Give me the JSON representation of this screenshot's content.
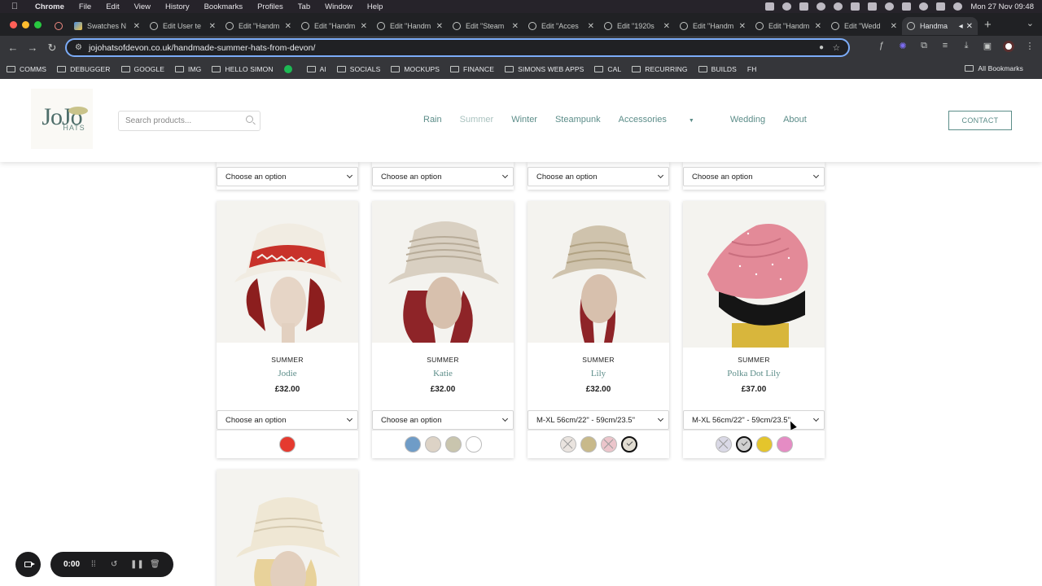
{
  "macos": {
    "app": "Chrome",
    "menus": [
      "File",
      "Edit",
      "View",
      "History",
      "Bookmarks",
      "Profiles",
      "Tab",
      "Window",
      "Help"
    ],
    "clock": "Mon 27 Nov  09:48"
  },
  "tabs": [
    {
      "title": "Swatches N"
    },
    {
      "title": "Edit User te"
    },
    {
      "title": "Edit \"Handm"
    },
    {
      "title": "Edit \"Handm"
    },
    {
      "title": "Edit \"Handm"
    },
    {
      "title": "Edit \"Steam"
    },
    {
      "title": "Edit \"Acces"
    },
    {
      "title": "Edit \"1920s"
    },
    {
      "title": "Edit \"Handm"
    },
    {
      "title": "Edit \"Handm"
    },
    {
      "title": "Edit \"Wedd"
    },
    {
      "title": "Handma"
    }
  ],
  "browser": {
    "url": "jojohatsofdevon.co.uk/handmade-summer-hats-from-devon/"
  },
  "bookmarks": [
    "COMMS",
    "DEBUGGER",
    "GOOGLE",
    "IMG",
    "HELLO SIMON",
    "AI",
    "SOCIALS",
    "MOCKUPS",
    "FINANCE",
    "SIMONS WEB APPS",
    "CAL",
    "RECURRING",
    "BUILDS",
    "FH"
  ],
  "bookmarks_all": "All Bookmarks",
  "site": {
    "logo_top": "JoJo",
    "logo_bottom": "HATS",
    "search_placeholder": "Search products...",
    "nav": [
      "Rain",
      "Summer",
      "Winter",
      "Steampunk",
      "Accessories",
      "Wedding",
      "About"
    ],
    "contact": "CONTACT"
  },
  "top_selects": [
    "Choose an option",
    "Choose an option",
    "Choose an option",
    "Choose an option"
  ],
  "products": [
    {
      "category": "SUMMER",
      "name": "Jodie",
      "price": "£32.00",
      "option": "Choose an option",
      "swatches": [
        {
          "color": "#e53a2f",
          "selected": false,
          "unavailable": false
        }
      ]
    },
    {
      "category": "SUMMER",
      "name": "Katie",
      "price": "£32.00",
      "option": "Choose an option",
      "swatches": [
        {
          "color": "#6f9cc7",
          "selected": false,
          "unavailable": false
        },
        {
          "color": "#ddd3c6",
          "selected": false,
          "unavailable": false
        },
        {
          "color": "#c9c5ae",
          "selected": false,
          "unavailable": false
        },
        {
          "color": "#ffffff",
          "selected": false,
          "unavailable": false
        }
      ]
    },
    {
      "category": "SUMMER",
      "name": "Lily",
      "price": "£32.00",
      "option": "M-XL 56cm/22\" - 59cm/23.5\"",
      "swatches": [
        {
          "color": "#eae4df",
          "selected": false,
          "unavailable": true
        },
        {
          "color": "#c8b98a",
          "selected": false,
          "unavailable": false
        },
        {
          "color": "#ecc5cb",
          "selected": false,
          "unavailable": true
        },
        {
          "color": "#e2ddd2",
          "selected": true,
          "unavailable": false
        }
      ]
    },
    {
      "category": "SUMMER",
      "name": "Polka Dot Lily",
      "price": "£37.00",
      "option": "M-XL 56cm/22\" - 59cm/23.5\"",
      "swatches": [
        {
          "color": "#dad9e6",
          "selected": false,
          "unavailable": true
        },
        {
          "color": "#cfcfcf",
          "selected": true,
          "unavailable": false
        },
        {
          "color": "#e4c52c",
          "selected": false,
          "unavailable": false
        },
        {
          "color": "#e58cc4",
          "selected": false,
          "unavailable": false
        }
      ]
    }
  ],
  "recorder": {
    "time": "0:00"
  }
}
